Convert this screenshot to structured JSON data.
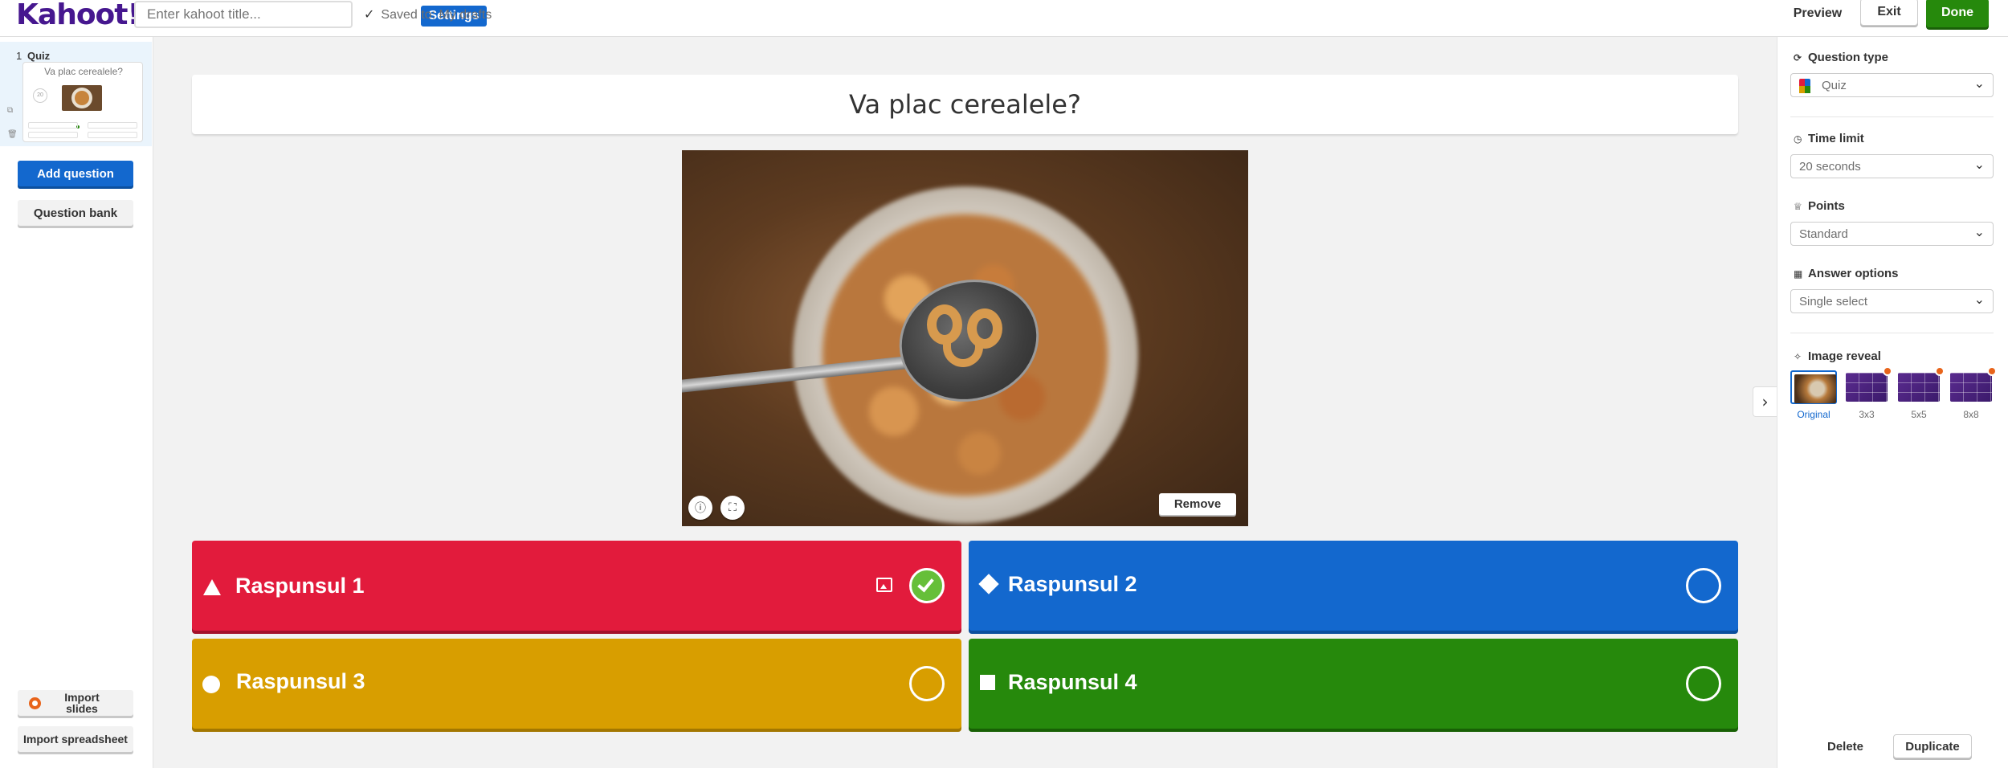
{
  "header": {
    "logo": "Kahoot!",
    "title_placeholder": "Enter kahoot title...",
    "settings_label": "Settings",
    "saved_text": "Saved to: My drafts",
    "preview_label": "Preview",
    "exit_label": "Exit",
    "done_label": "Done"
  },
  "sidebar": {
    "slides": [
      {
        "number": "1",
        "type": "Quiz",
        "title": "Va plac cerealele?",
        "timer": "20"
      }
    ],
    "add_question_label": "Add question",
    "question_bank_label": "Question bank",
    "import_slides_label": "Import slides",
    "import_spreadsheet_label": "Import spreadsheet"
  },
  "question": {
    "text": "Va plac cerealele?",
    "image_remove_label": "Remove",
    "info_icon": "info-icon",
    "crop_icon": "crop-icon"
  },
  "answers": [
    {
      "text": "Raspunsul 1",
      "shape": "triangle",
      "color": "#e21b3c",
      "correct": true
    },
    {
      "text": "Raspunsul 2",
      "shape": "diamond",
      "color": "#1368ce",
      "correct": false
    },
    {
      "text": "Raspunsul 3",
      "shape": "circle",
      "color": "#d89e00",
      "correct": false
    },
    {
      "text": "Raspunsul 4",
      "shape": "square",
      "color": "#26890c",
      "correct": false
    }
  ],
  "settings_panel": {
    "question_type": {
      "label": "Question type",
      "value": "Quiz"
    },
    "time_limit": {
      "label": "Time limit",
      "value": "20 seconds"
    },
    "points": {
      "label": "Points",
      "value": "Standard"
    },
    "answer_options": {
      "label": "Answer options",
      "value": "Single select"
    },
    "image_reveal": {
      "label": "Image reveal",
      "options": [
        "Original",
        "3x3",
        "5x5",
        "8x8"
      ],
      "selected": "Original"
    },
    "delete_label": "Delete",
    "duplicate_label": "Duplicate"
  },
  "colors": {
    "brand": "#46178f",
    "primary_blue": "#1368ce",
    "done_green": "#26890c",
    "correct_green": "#66bf39"
  }
}
